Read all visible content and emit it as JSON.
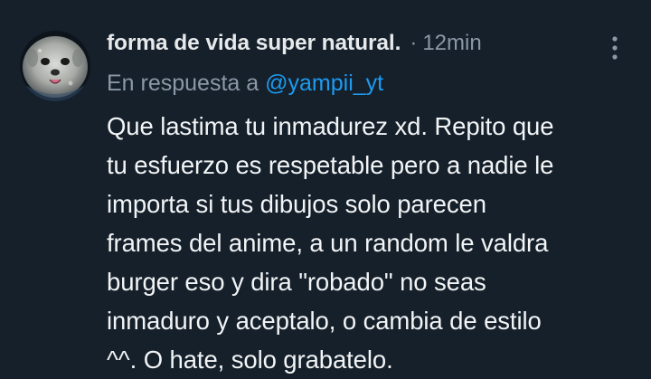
{
  "tweet": {
    "author": {
      "display_name": "forma de vida super natural.",
      "avatar_icon": "face-avatar"
    },
    "separator": "·",
    "timestamp": "12min",
    "more_icon": "more-vertical-icon",
    "reply_prefix": "En respuesta a",
    "reply_to_handle": "@yampii_yt",
    "text": "Que lastima tu inmadurez xd. Repito que\ntu esfuerzo es respetable pero a nadie le\nimporta si tus dibujos solo parecen\nframes del anime, a un random le valdra\nburger eso y dira \"robado\" no seas\ninmaduro y aceptalo, o cambia de estilo\n^^. O hate, solo grabatelo."
  },
  "colors": {
    "background": "#15202b",
    "primary_text": "#e7e9ea",
    "secondary_text": "#8b98a5",
    "link": "#1d9bf0"
  }
}
